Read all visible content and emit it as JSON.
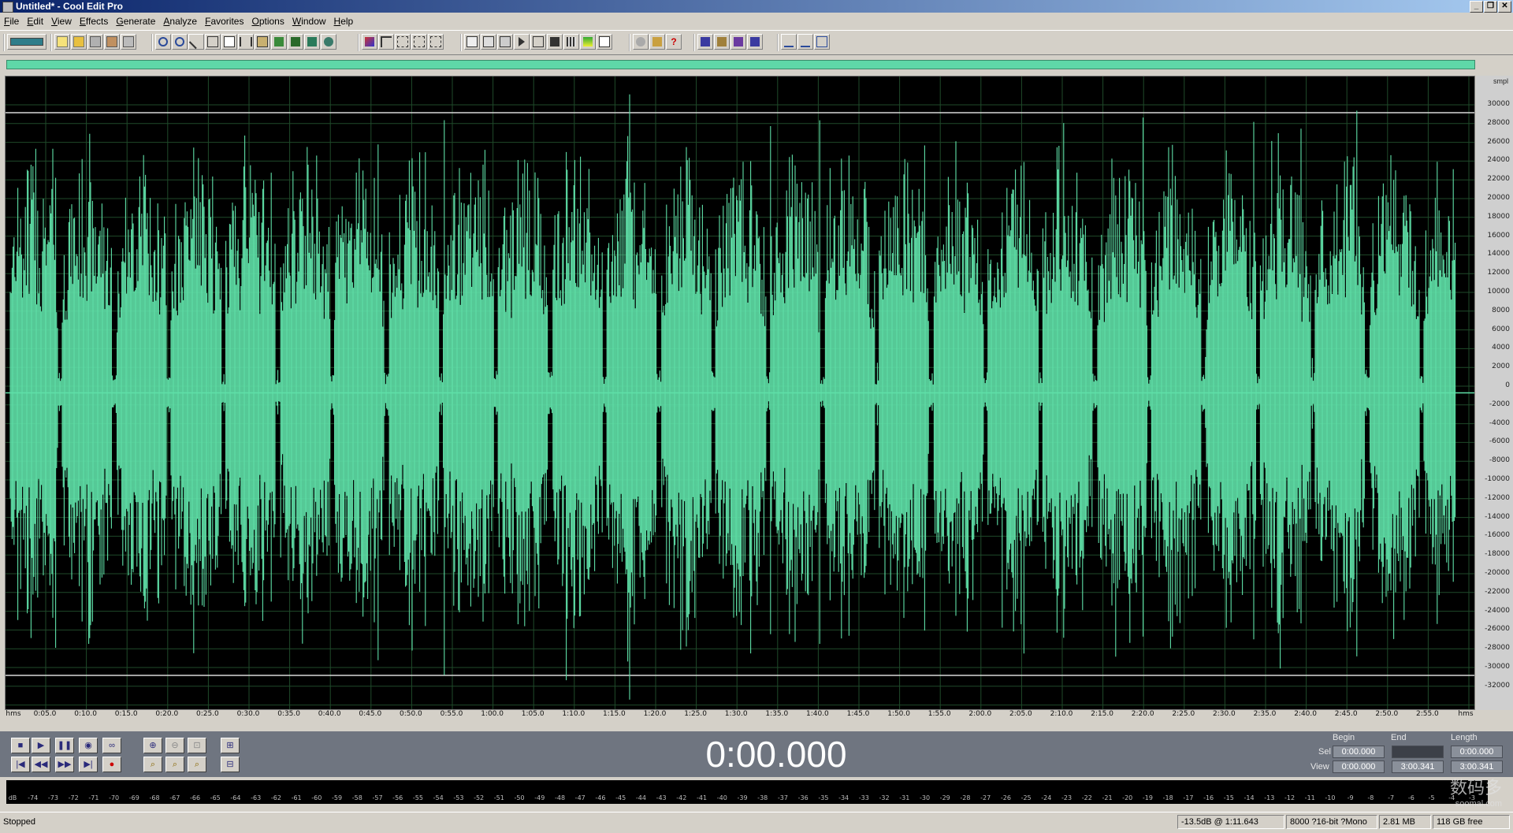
{
  "window": {
    "title": "Untitled* - Cool Edit Pro",
    "controls": [
      "_",
      "❐",
      "✕"
    ]
  },
  "menu": [
    "File",
    "Edit",
    "View",
    "Effects",
    "Generate",
    "Analyze",
    "Favorites",
    "Options",
    "Window",
    "Help"
  ],
  "amplitude_ruler": {
    "unit": "smpl",
    "labels": [
      "30000",
      "28000",
      "26000",
      "24000",
      "22000",
      "20000",
      "18000",
      "16000",
      "14000",
      "12000",
      "10000",
      "8000",
      "6000",
      "4000",
      "2000",
      "0",
      "-2000",
      "-4000",
      "-6000",
      "-8000",
      "-10000",
      "-12000",
      "-14000",
      "-16000",
      "-18000",
      "-20000",
      "-22000",
      "-24000",
      "-26000",
      "-28000",
      "-30000",
      "-32000"
    ]
  },
  "timeline": {
    "start": "hms",
    "end": "hms",
    "labels": [
      "0:05.0",
      "0:10.0",
      "0:15.0",
      "0:20.0",
      "0:25.0",
      "0:30.0",
      "0:35.0",
      "0:40.0",
      "0:45.0",
      "0:50.0",
      "0:55.0",
      "1:00.0",
      "1:05.0",
      "1:10.0",
      "1:15.0",
      "1:20.0",
      "1:25.0",
      "1:30.0",
      "1:35.0",
      "1:40.0",
      "1:45.0",
      "1:50.0",
      "1:55.0",
      "2:00.0",
      "2:05.0",
      "2:10.0",
      "2:15.0",
      "2:20.0",
      "2:25.0",
      "2:30.0",
      "2:35.0",
      "2:40.0",
      "2:45.0",
      "2:50.0",
      "2:55.0"
    ]
  },
  "time_display": "0:00.000",
  "selection": {
    "headers": {
      "begin": "Begin",
      "end": "End",
      "length": "Length"
    },
    "sel": {
      "label": "Sel",
      "begin": "0:00.000",
      "end": "",
      "length": "0:00.000"
    },
    "view": {
      "label": "View",
      "begin": "0:00.000",
      "end": "3:00.341",
      "length": "3:00.341"
    }
  },
  "meter": {
    "labels": [
      "dB",
      "-74",
      "-73",
      "-72",
      "-71",
      "-70",
      "-69",
      "-68",
      "-67",
      "-66",
      "-65",
      "-64",
      "-63",
      "-62",
      "-61",
      "-60",
      "-59",
      "-58",
      "-57",
      "-56",
      "-55",
      "-54",
      "-53",
      "-52",
      "-51",
      "-50",
      "-49",
      "-48",
      "-47",
      "-46",
      "-45",
      "-44",
      "-43",
      "-42",
      "-41",
      "-40",
      "-39",
      "-38",
      "-37",
      "-36",
      "-35",
      "-34",
      "-33",
      "-32",
      "-31",
      "-30",
      "-29",
      "-28",
      "-27",
      "-26",
      "-25",
      "-24",
      "-23",
      "-22",
      "-21",
      "-20",
      "-19",
      "-18",
      "-17",
      "-16",
      "-15",
      "-14",
      "-13",
      "-12",
      "-11",
      "-10",
      "-9",
      "-8",
      "-7",
      "-6",
      "-5",
      "-4",
      "-3"
    ]
  },
  "status": {
    "state": "Stopped",
    "cursor": "-13.5dB @  1:11.643",
    "format": "8000 ?16-bit ?Mono",
    "size": "2.81 MB",
    "free": "118 GB free"
  },
  "watermark": {
    "cn": "数码多",
    "site": "soomal.com"
  },
  "colors": {
    "waveform": "#5fe0a8",
    "background": "#000000",
    "grid": "#1f4a2a",
    "panel": "#6f7580"
  }
}
